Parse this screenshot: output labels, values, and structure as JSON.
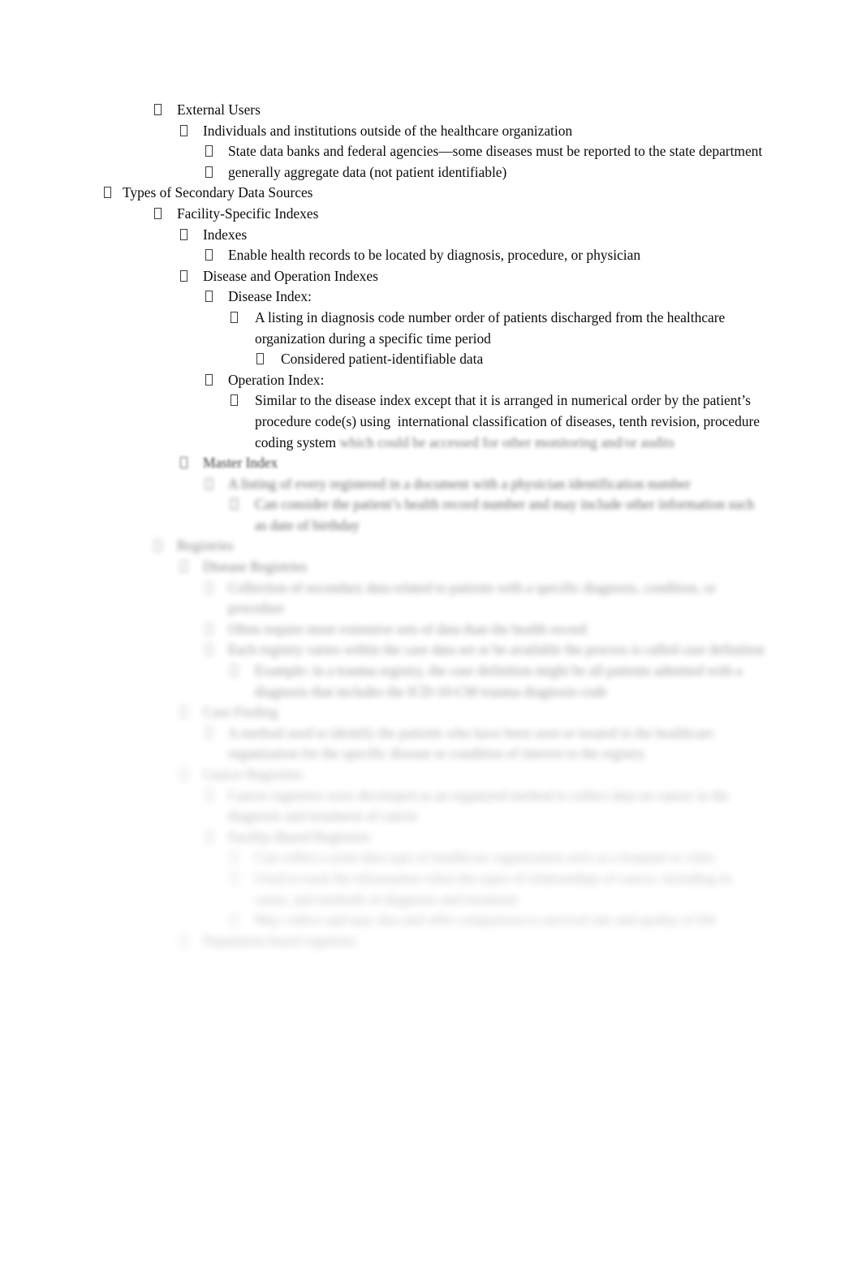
{
  "document": {
    "background_color": "#ffffff",
    "text_color": "#0b0b0b",
    "bullet_glyph": "missing-glyph-box",
    "outline": [
      {
        "level": 1,
        "blur": 0,
        "text": "External Users"
      },
      {
        "level": 2,
        "blur": 0,
        "text": "Individuals and institutions outside of the healthcare organization"
      },
      {
        "level": 3,
        "blur": 0,
        "text": "State data banks and federal agencies—some diseases must be reported to the state department"
      },
      {
        "level": 3,
        "blur": 0,
        "text": "generally aggregate data (not patient identifiable)"
      },
      {
        "level": 0,
        "blur": 0,
        "text": "Types of Secondary Data Sources"
      },
      {
        "level": 1,
        "blur": 0,
        "text": "Facility-Specific Indexes"
      },
      {
        "level": 2,
        "blur": 0,
        "text": "Indexes"
      },
      {
        "level": 3,
        "blur": 0,
        "text": "Enable health records to be located by diagnosis, procedure, or physician"
      },
      {
        "level": 2,
        "blur": 0,
        "text": "Disease and Operation Indexes"
      },
      {
        "level": 3,
        "blur": 0,
        "text": "Disease Index:"
      },
      {
        "level": 4,
        "blur": 0,
        "text": "A listing in diagnosis code number order of patients discharged from the healthcare organization during a specific time period"
      },
      {
        "level": 5,
        "blur": 0,
        "text": "Considered patient-identifiable data"
      },
      {
        "level": 3,
        "blur": 0,
        "text": "Operation Index:"
      },
      {
        "level": 4,
        "blur": 0,
        "text": "Similar to the disease index except that it is arranged in numerical order by the patient’s procedure code(s) using  international classification of diseases, tenth revision, procedure coding system ",
        "tail": "which could be accessed for other monitoring and/or audits"
      },
      {
        "level": 2,
        "blur": 2,
        "text": "Master Index"
      },
      {
        "level": 3,
        "blur": 3,
        "text": "A listing of every registered in a document with a physician identification number"
      },
      {
        "level": 4,
        "blur": 3,
        "text": "Can consider the patient’s health record number and may include other information such as date of birthday"
      },
      {
        "level": 1,
        "blur": 4,
        "text": "Registries"
      },
      {
        "level": 2,
        "blur": 4,
        "text": "Disease Registries"
      },
      {
        "level": 3,
        "blur": 5,
        "text": "Collection of secondary data related to patients with a specific diagnosis, condition, or procedure"
      },
      {
        "level": 3,
        "blur": 5,
        "text": "Often require more extensive sets of data than the health record"
      },
      {
        "level": 3,
        "blur": 5,
        "text": "Each registry varies within the case data set or be available the process is called case definition"
      },
      {
        "level": 4,
        "blur": 5,
        "text": "Example: in a trauma registry, the case definition might be all patients admitted with a diagnosis that includes the ICD-10-CM trauma diagnosis code"
      },
      {
        "level": 2,
        "blur": 6,
        "text": "Case Finding"
      },
      {
        "level": 3,
        "blur": 6,
        "text": "A method used to identify the patients who have been seen or treated in the healthcare organization for the specific disease or condition of interest to the registry"
      },
      {
        "level": 2,
        "blur": 7,
        "text": "Cancer Registries"
      },
      {
        "level": 3,
        "blur": 7,
        "text": "Cancer registries were developed as an organized method to collect data on cancer in the diagnosis and treatment of cancer"
      },
      {
        "level": 3,
        "blur": 7,
        "text": "Facility-Based Registries"
      },
      {
        "level": 4,
        "blur": 8,
        "text": "Can collect a joint data type of healthcare organization such as a hospital or clinic"
      },
      {
        "level": 4,
        "blur": 8,
        "text": "Used to track the information when the types of relationships of cancer, including its cause, and methods of diagnosis and treatment"
      },
      {
        "level": 4,
        "blur": 8,
        "text": "May collect and may also and offer comparison to survival rate and quality of life"
      },
      {
        "level": 2,
        "blur": 8,
        "text": "Population-based registries"
      }
    ]
  }
}
